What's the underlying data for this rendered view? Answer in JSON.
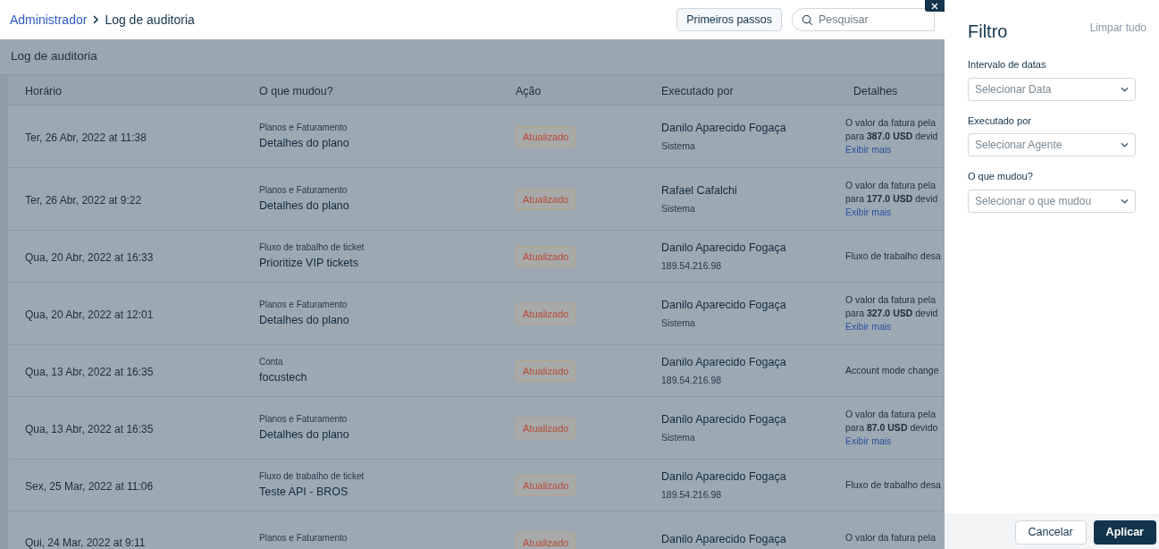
{
  "breadcrumb": {
    "parent": "Administrador",
    "current": "Log de auditoria"
  },
  "header": {
    "button": "Primeiros passos",
    "search": {
      "placeholder": "Pesquisar"
    }
  },
  "page_title": "Log de auditoria",
  "table": {
    "columns": [
      "Horário",
      "O que mudou?",
      "Ação",
      "Executado por",
      "Detalhes"
    ],
    "rows": [
      {
        "time": "Ter, 26 Abr, 2022 at 11:38",
        "category": "Planos e Faturamento",
        "item": "Detalhes do plano",
        "action": "Atualizado",
        "actor": "Danilo Aparecido Fogaça",
        "source": "Sistema",
        "details": [
          "O valor da fatura pela",
          "para **387.0 USD** devid"
        ],
        "link": "Exibir mais"
      },
      {
        "time": "Ter, 26 Abr, 2022 at 9:22",
        "category": "Planos e Faturamento",
        "item": "Detalhes do plano",
        "action": "Atualizado",
        "actor": "Rafael Cafalchi",
        "source": "Sistema",
        "details": [
          "O valor da fatura pela",
          "para **177.0 USD** devid"
        ],
        "link": "Exibir mais"
      },
      {
        "time": "Qua, 20 Abr, 2022 at 16:33",
        "category": "Fluxo de trabalho de ticket",
        "item": "Prioritize VIP tickets",
        "action": "Atualizado",
        "actor": "Danilo Aparecido Fogaça",
        "source": "189.54.216.98",
        "details": [
          "Fluxo de trabalho desa"
        ]
      },
      {
        "time": "Qua, 20 Abr, 2022 at 12:01",
        "category": "Planos e Faturamento",
        "item": "Detalhes do plano",
        "action": "Atualizado",
        "actor": "Danilo Aparecido Fogaça",
        "source": "Sistema",
        "details": [
          "O valor da fatura pela",
          "para **327.0 USD** devid"
        ],
        "link": "Exibir mais"
      },
      {
        "time": "Qua, 13 Abr, 2022 at 16:35",
        "category": "Conta",
        "item": "focustech",
        "action": "Atualizado",
        "actor": "Danilo Aparecido Fogaça",
        "source": "189.54.216.98",
        "details": [
          "Account mode change"
        ]
      },
      {
        "time": "Qua, 13 Abr, 2022 at 16:35",
        "category": "Planos e Faturamento",
        "item": "Detalhes do plano",
        "action": "Atualizado",
        "actor": "Danilo Aparecido Fogaça",
        "source": "Sistema",
        "details": [
          "O valor da fatura pela",
          "para **87.0 USD** devido"
        ],
        "link": "Exibir mais"
      },
      {
        "time": "Sex, 25 Mar, 2022 at 11:06",
        "category": "Fluxo de trabalho de ticket",
        "item": "Teste API - BROS",
        "action": "Atualizado",
        "actor": "Danilo Aparecido Fogaça",
        "source": "189.54.216.98",
        "details": [
          "Fluxo de trabalho desa"
        ]
      },
      {
        "time": "Qui, 24 Mar, 2022 at 9:11",
        "category": "Planos e Faturamento",
        "action": "Atualizado",
        "actor": "Danilo Aparecido Fogaça",
        "details": [
          "O valor da fatura pela"
        ]
      }
    ]
  },
  "filter": {
    "title": "Filtro",
    "clear": "Limpar tudo",
    "fields": [
      {
        "label": "Intervalo de datas",
        "placeholder": "Selecionar Data"
      },
      {
        "label": "Executado por",
        "placeholder": "Selecionar Agente"
      },
      {
        "label": "O que mudou?",
        "placeholder": "Selecionar o que mudou"
      }
    ],
    "buttons": {
      "cancel": "Cancelar",
      "apply": "Aplicar"
    }
  }
}
